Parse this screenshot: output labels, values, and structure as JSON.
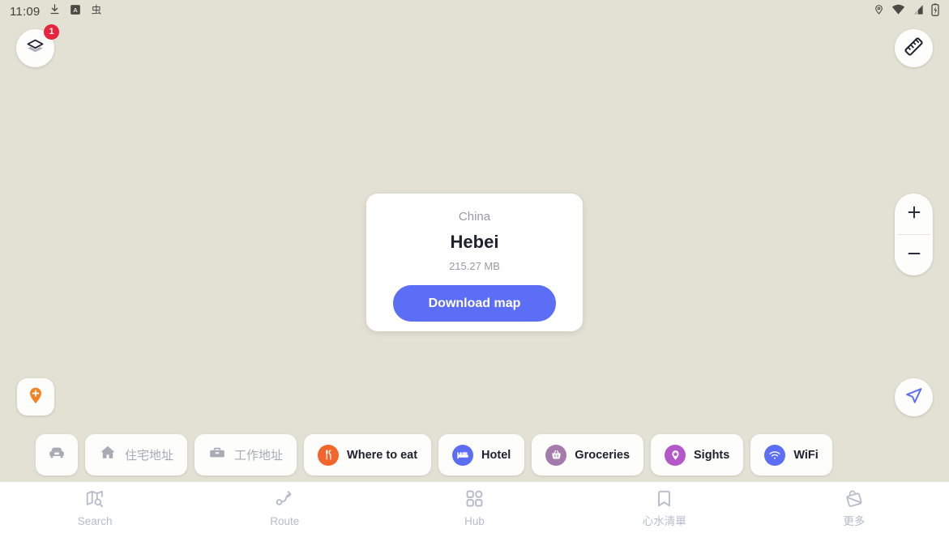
{
  "statusbar": {
    "clock": "11:09",
    "left_icons": [
      "download-icon",
      "app-badge-icon",
      "chinese-glyph-icon"
    ],
    "right_icons": [
      "location-icon",
      "wifi-icon",
      "signal-icon",
      "battery-charging-icon"
    ]
  },
  "map_controls": {
    "layers_icon": "layers-icon",
    "layers_badge": "1",
    "ruler_icon": "ruler-icon",
    "zoom_in_icon": "plus-icon",
    "zoom_out_icon": "minus-icon",
    "add_point_icon": "add-pin-icon",
    "locate_icon": "navigation-arrow-icon"
  },
  "download_card": {
    "country": "China",
    "region": "Hebei",
    "size": "215.27 MB",
    "button_label": "Download map",
    "button_color": "#5b6ef5"
  },
  "chips": [
    {
      "label": "",
      "icon": "car-icon",
      "icon_only": true,
      "badge_color": "",
      "muted": true
    },
    {
      "label": "住宅地址",
      "icon": "home-icon",
      "icon_only": false,
      "badge_color": "",
      "muted": true
    },
    {
      "label": "工作地址",
      "icon": "briefcase-icon",
      "icon_only": false,
      "badge_color": "",
      "muted": true
    },
    {
      "label": "Where to eat",
      "icon": "restaurant-icon",
      "icon_only": false,
      "badge_color": "#f3662b",
      "muted": false
    },
    {
      "label": "Hotel",
      "icon": "hotel-bed-icon",
      "icon_only": false,
      "badge_color": "#5b6ef5",
      "muted": false
    },
    {
      "label": "Groceries",
      "icon": "basket-icon",
      "icon_only": false,
      "badge_color": "#a57bab",
      "muted": false
    },
    {
      "label": "Sights",
      "icon": "sights-pin-icon",
      "icon_only": false,
      "badge_color": "#b457c9",
      "muted": false
    },
    {
      "label": "WiFi",
      "icon": "wifi-icon",
      "icon_only": false,
      "badge_color": "#5b6ef5",
      "muted": false
    }
  ],
  "bottom_nav": [
    {
      "label": "Search",
      "icon": "map-search-icon"
    },
    {
      "label": "Route",
      "icon": "route-icon"
    },
    {
      "label": "Hub",
      "icon": "grid-hub-icon"
    },
    {
      "label": "心水清單",
      "icon": "bookmark-icon"
    },
    {
      "label": "更多",
      "icon": "more-bag-icon"
    }
  ],
  "theme": {
    "map_background": "#e3e0d4",
    "surface": "#fdfdfb",
    "accent": "#5b6ef5",
    "badge_red": "#e8243c",
    "muted_text": "#b9bacb"
  }
}
